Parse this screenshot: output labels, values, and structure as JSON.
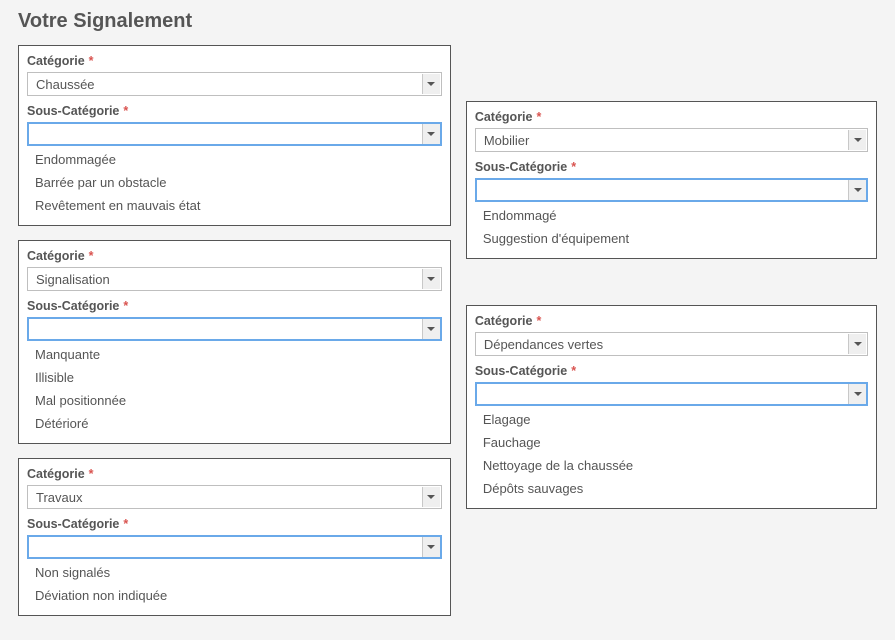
{
  "page": {
    "title": "Votre Signalement"
  },
  "labels": {
    "categorie": "Catégorie",
    "sous_categorie": "Sous-Catégorie",
    "required_mark": "*"
  },
  "panels": [
    {
      "column": "left",
      "categorie_value": "Chaussée",
      "sous_categorie_value": "",
      "options": [
        "Endommagée",
        "Barrée par un obstacle",
        "Revêtement en mauvais état"
      ]
    },
    {
      "column": "left",
      "categorie_value": "Signalisation",
      "sous_categorie_value": "",
      "options": [
        "Manquante",
        "Illisible",
        "Mal positionnée",
        "Détérioré"
      ]
    },
    {
      "column": "left",
      "categorie_value": "Travaux",
      "sous_categorie_value": "",
      "options": [
        "Non signalés",
        "Déviation non indiquée"
      ]
    },
    {
      "column": "right",
      "categorie_value": "Mobilier",
      "sous_categorie_value": "",
      "options": [
        "Endommagé",
        "Suggestion d'équipement"
      ]
    },
    {
      "column": "right",
      "categorie_value": "Dépendances vertes",
      "sous_categorie_value": "",
      "options": [
        "Elagage",
        "Fauchage",
        "Nettoyage de la chaussée",
        "Dépôts sauvages"
      ]
    }
  ]
}
